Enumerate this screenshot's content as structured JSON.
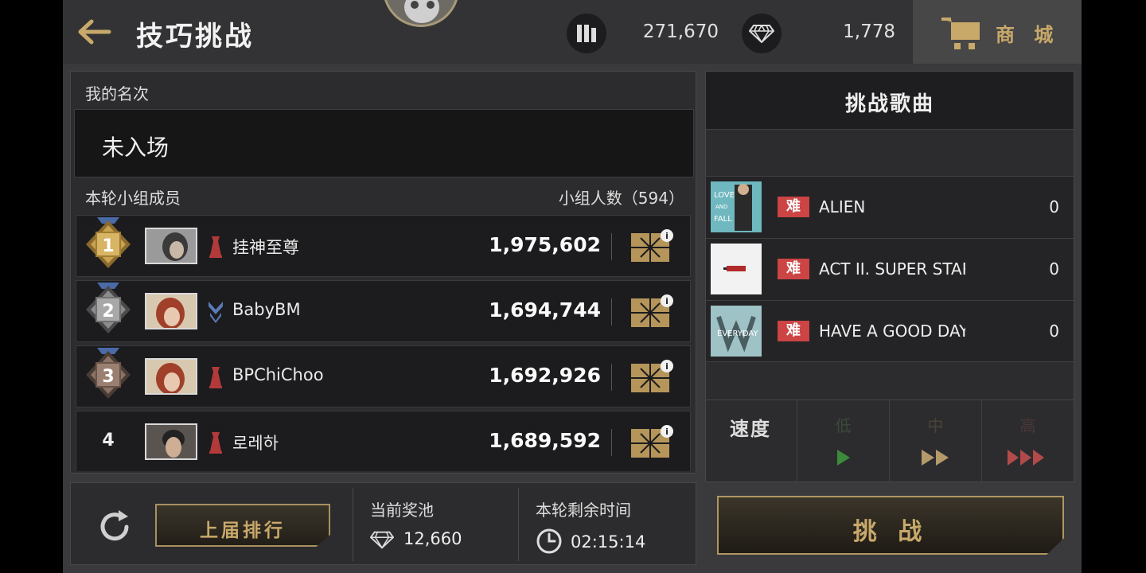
{
  "header": {
    "title": "技巧挑战",
    "currency1_value": "271,670",
    "currency2_value": "1,778",
    "shop_label": "商 城"
  },
  "my_rank": {
    "label": "我的名次",
    "value": "未入场"
  },
  "group": {
    "label": "本轮小组成员",
    "count_label": "小组人数（594）"
  },
  "members": [
    {
      "rank": "1",
      "name": "挂神至尊",
      "score": "1,975,602",
      "medal": "gold",
      "tier": "red"
    },
    {
      "rank": "2",
      "name": "BabyBM",
      "score": "1,694,744",
      "medal": "silver",
      "tier": "blue"
    },
    {
      "rank": "3",
      "name": "BPChiChoo",
      "score": "1,692,926",
      "medal": "bronze",
      "tier": "red"
    },
    {
      "rank": "4",
      "name": "로레하",
      "score": "1,689,592",
      "medal": "none",
      "tier": "red"
    }
  ],
  "bottom": {
    "prev_rank_label": "上届排行",
    "pool_label": "当前奖池",
    "pool_value": "12,660",
    "time_label": "本轮剩余时间",
    "time_value": "02:15:14"
  },
  "songs": {
    "title": "挑战歌曲",
    "items": [
      {
        "difficulty": "难",
        "name": "ALIEN",
        "score": "0"
      },
      {
        "difficulty": "难",
        "name": "ACT II. SUPER STAR",
        "score": "0"
      },
      {
        "difficulty": "难",
        "name": "HAVE A GOOD DAY",
        "score": "0"
      }
    ]
  },
  "speed": {
    "label": "速度",
    "options": [
      "低",
      "中",
      "高"
    ]
  },
  "challenge_label": "挑 战",
  "colors": {
    "gold": "#c8a96a",
    "difficulty_red": "#cc4444",
    "speed_low": "#3c8a3c",
    "speed_mid": "#b49a6a",
    "speed_high": "#b24a4a"
  }
}
